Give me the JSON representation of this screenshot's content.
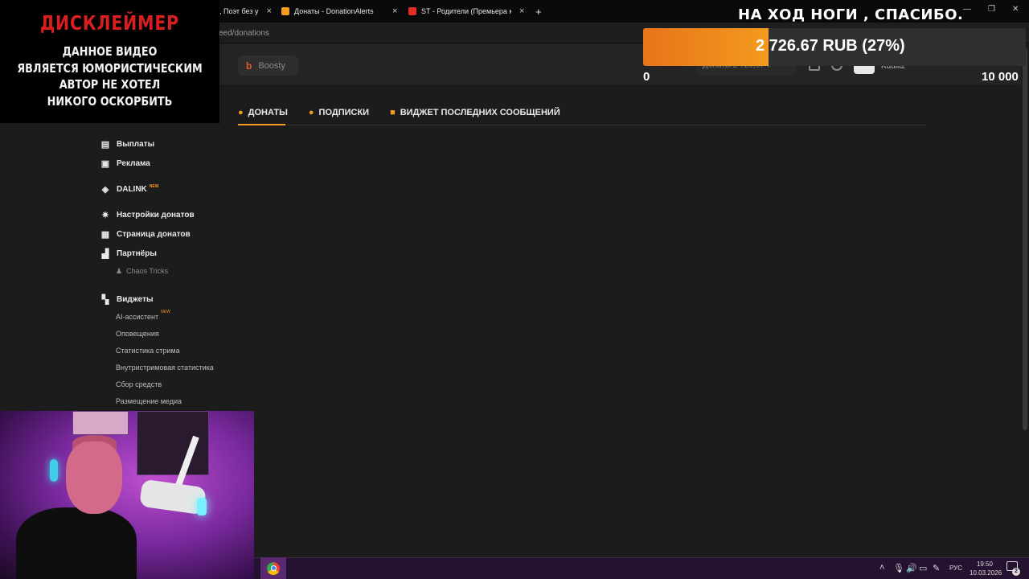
{
  "browser": {
    "tabs": [
      {
        "label": ", Поэт без у",
        "close": "×"
      },
      {
        "label": "Донаты - DonationAlerts",
        "close": "×"
      },
      {
        "label": "ST - Родители (Премьера кли",
        "close": "×"
      }
    ],
    "new_tab": "+",
    "url": "eed/donations",
    "window_buttons": {
      "minimize": "—",
      "restore": "❐",
      "close": "✕"
    }
  },
  "header": {
    "boosty": "Boosty",
    "balance": "Донаты 2 726,67 ▾",
    "username": "Kdulltz"
  },
  "page_tabs": [
    {
      "label": "ДОНАТЫ",
      "icon": "donate-icon"
    },
    {
      "label": "ПОДПИСКИ",
      "icon": "user-icon"
    },
    {
      "label": "ВИДЖЕТ ПОСЛЕДНИХ СООБЩЕНИЙ",
      "icon": "widget-icon"
    }
  ],
  "sidebar": {
    "items": [
      {
        "label": "Выплаты",
        "icon": "wallet-icon"
      },
      {
        "label": "Реклама",
        "icon": "briefcase-icon"
      },
      {
        "label": "DALINK",
        "icon": "dalink-icon",
        "badge": "NEW"
      },
      {
        "label": "Настройки донатов",
        "icon": "gear-icon"
      },
      {
        "label": "Страница донатов",
        "icon": "layout-icon"
      },
      {
        "label": "Партнёры",
        "icon": "partners-icon"
      },
      {
        "label": "Виджеты",
        "icon": "widgets-icon"
      }
    ],
    "partner_sub": "Chaos Tricks",
    "widget_subs": [
      {
        "label": "AI-ассистент",
        "badge": "NEW"
      },
      {
        "label": "Оповещения"
      },
      {
        "label": "Статистика стрима"
      },
      {
        "label": "Внутристримовая статистика"
      },
      {
        "label": "Сбор средств"
      },
      {
        "label": "Размещение медиа"
      }
    ]
  },
  "disclaimer": {
    "title": "ДИСКЛЕЙМЕР",
    "lines": [
      "ДАННОЕ ВИДЕО",
      "ЯВЛЯЕТСЯ ЮМОРИСТИЧЕСКИМ",
      "АВТОР НЕ ХОТЕЛ",
      "НИКОГО ОСКОРБИТЬ"
    ]
  },
  "goal": {
    "title": "НА ХОД НОГИ , СПАСИБО.",
    "amount": "2 726.67 RUB (27%)",
    "min": "0",
    "max": "10 000",
    "progress": 0.27,
    "color": "#f39a1f"
  },
  "taskbar": {
    "lang": "РУС",
    "time": "19:50",
    "date": "10.03.2026",
    "notifications": "2"
  },
  "colors": {
    "accent": "#f39a1f",
    "disclaimer_title": "#d81e1e",
    "background": "#1c1c1c"
  }
}
